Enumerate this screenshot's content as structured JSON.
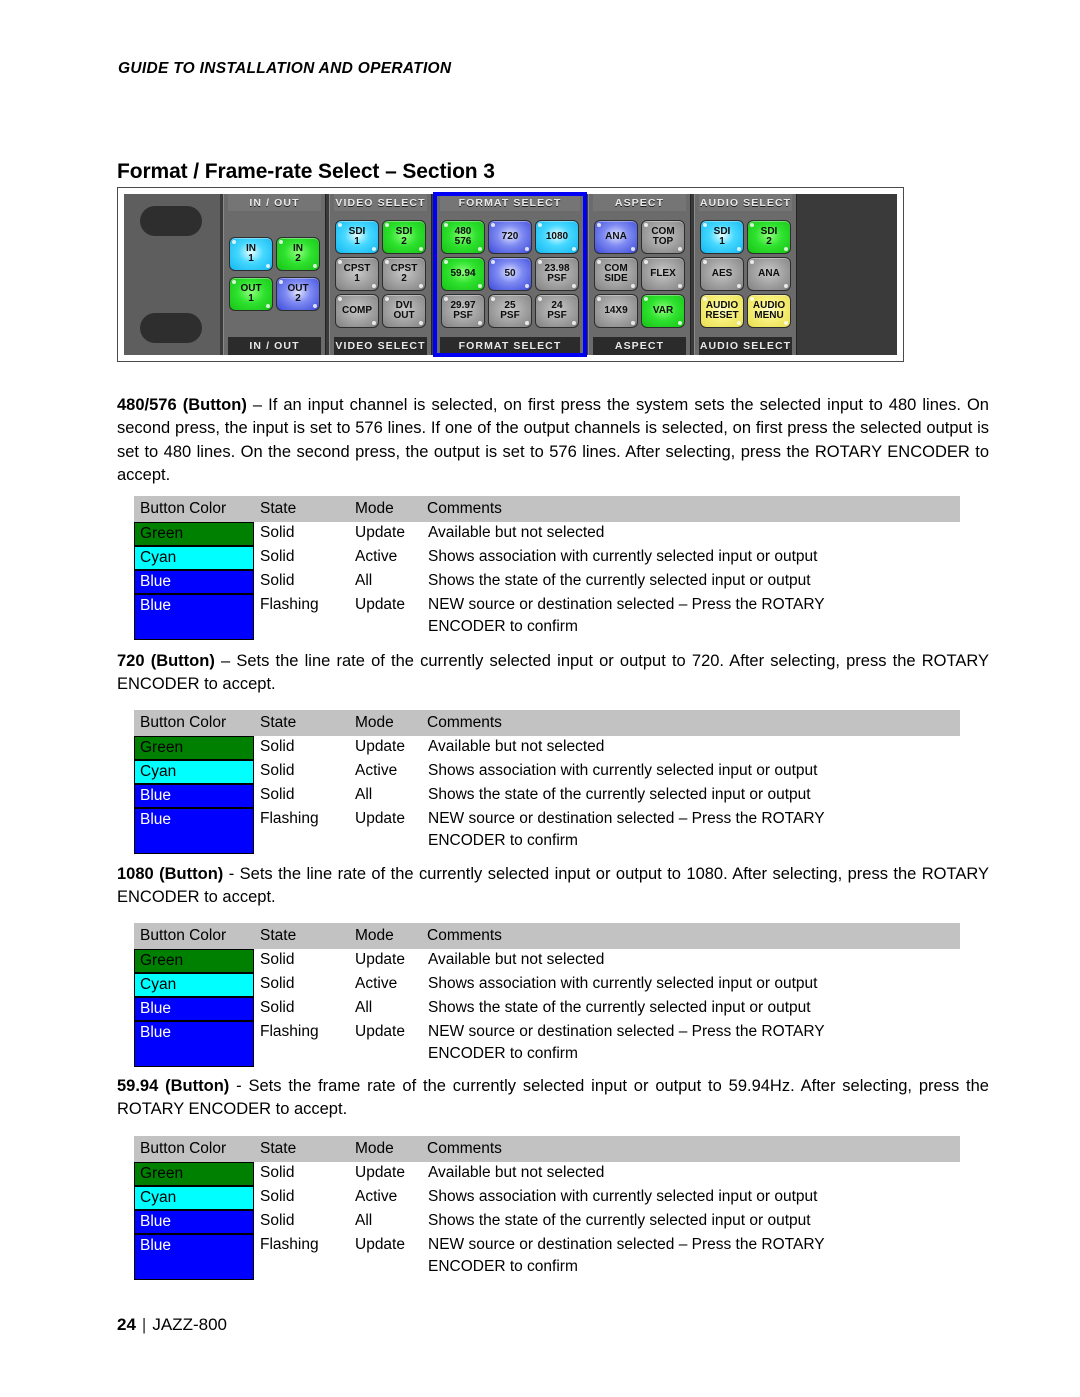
{
  "running_head": "GUIDE TO INSTALLATION AND OPERATION",
  "section_title": "Format / Frame-rate Select – Section 3",
  "footer": {
    "page_number": "24",
    "separator": "|",
    "product": "JAZZ-800"
  },
  "panel": {
    "groups": [
      {
        "name": "in-out",
        "label_top": "IN / OUT",
        "label_bottom": "IN / OUT",
        "columns": 2,
        "buttons": [
          {
            "label": "IN 1",
            "lines": [
              "IN",
              "1"
            ],
            "color": "cyan"
          },
          {
            "label": "IN 2",
            "lines": [
              "IN",
              "2"
            ],
            "color": "green"
          },
          {
            "label": "",
            "lines": [],
            "color": "empty"
          },
          {
            "label": "",
            "lines": [],
            "color": "empty"
          },
          {
            "label": "OUT 1",
            "lines": [
              "OUT",
              "1"
            ],
            "color": "green"
          },
          {
            "label": "OUT 2",
            "lines": [
              "OUT",
              "2"
            ],
            "color": "blue"
          }
        ]
      },
      {
        "name": "video-select",
        "label_top": "VIDEO SELECT",
        "label_bottom": "VIDEO SELECT",
        "columns": 2,
        "buttons": [
          {
            "label": "SDI 1",
            "lines": [
              "SDI",
              "1"
            ],
            "color": "cyan"
          },
          {
            "label": "SDI 2",
            "lines": [
              "SDI",
              "2"
            ],
            "color": "green"
          },
          {
            "label": "CPST 1",
            "lines": [
              "CPST",
              "1"
            ],
            "color": "gray"
          },
          {
            "label": "CPST 2",
            "lines": [
              "CPST",
              "2"
            ],
            "color": "gray"
          },
          {
            "label": "COMP",
            "lines": [
              "COMP"
            ],
            "color": "gray"
          },
          {
            "label": "DVI OUT",
            "lines": [
              "DVI",
              "OUT"
            ],
            "color": "gray"
          }
        ]
      },
      {
        "name": "format-select",
        "label_top": "FORMAT SELECT",
        "label_bottom": "FORMAT SELECT",
        "columns": 3,
        "highlighted": true,
        "buttons": [
          {
            "label": "480/576",
            "lines": [
              "480",
              "576"
            ],
            "color": "green"
          },
          {
            "label": "720",
            "lines": [
              "720"
            ],
            "color": "blue"
          },
          {
            "label": "1080",
            "lines": [
              "1080"
            ],
            "color": "cyan"
          },
          {
            "label": "59.94",
            "lines": [
              "59.94"
            ],
            "color": "green"
          },
          {
            "label": "50",
            "lines": [
              "50"
            ],
            "color": "blue"
          },
          {
            "label": "23.98 PSF",
            "lines": [
              "23.98",
              "PSF"
            ],
            "color": "gray"
          },
          {
            "label": "29.97 PSF",
            "lines": [
              "29.97",
              "PSF"
            ],
            "color": "gray"
          },
          {
            "label": "25 PSF",
            "lines": [
              "25",
              "PSF"
            ],
            "color": "gray"
          },
          {
            "label": "24 PSF",
            "lines": [
              "24",
              "PSF"
            ],
            "color": "gray"
          }
        ]
      },
      {
        "name": "aspect",
        "label_top": "ASPECT",
        "label_bottom": "ASPECT",
        "columns": 2,
        "buttons": [
          {
            "label": "ANA",
            "lines": [
              "ANA"
            ],
            "color": "blue"
          },
          {
            "label": "COM TOP",
            "lines": [
              "COM",
              "TOP"
            ],
            "color": "gray"
          },
          {
            "label": "COM SIDE",
            "lines": [
              "COM",
              "SIDE"
            ],
            "color": "gray"
          },
          {
            "label": "FLEX",
            "lines": [
              "FLEX"
            ],
            "color": "gray"
          },
          {
            "label": "14X9",
            "lines": [
              "14X9"
            ],
            "color": "gray"
          },
          {
            "label": "VAR",
            "lines": [
              "VAR"
            ],
            "color": "green"
          }
        ]
      },
      {
        "name": "audio-select",
        "label_top": "AUDIO SELECT",
        "label_bottom": "AUDIO SELECT",
        "columns": 2,
        "buttons": [
          {
            "label": "SDI 1",
            "lines": [
              "SDI",
              "1"
            ],
            "color": "cyan"
          },
          {
            "label": "SDI 2",
            "lines": [
              "SDI",
              "2"
            ],
            "color": "green"
          },
          {
            "label": "AES",
            "lines": [
              "AES"
            ],
            "color": "gray"
          },
          {
            "label": "ANA",
            "lines": [
              "ANA"
            ],
            "color": "gray"
          },
          {
            "label": "AUDIO RESET",
            "lines": [
              "AUDIO",
              "RESET"
            ],
            "color": "yellow"
          },
          {
            "label": "AUDIO MENU",
            "lines": [
              "AUDIO",
              "MENU"
            ],
            "color": "yellow"
          }
        ]
      }
    ]
  },
  "sections": [
    {
      "id": "sec-480-576",
      "term": "480/576 (Button)",
      "dash": " – ",
      "body": "If an input channel is selected, on first press the system sets the selected input to 480 lines. On second press, the input is set to 576 lines. If one of the output channels is selected, on first press the selected output is set to 480 lines. On the second press, the output is set to 576 lines. After selecting, press the ROTARY ENCODER to accept."
    },
    {
      "id": "sec-720",
      "term": "720 (Button)",
      "dash": " – ",
      "body": "Sets the line rate of the currently selected input or output to 720. After selecting, press the ROTARY ENCODER to accept."
    },
    {
      "id": "sec-1080",
      "term": "1080 (Button)",
      "dash": " - ",
      "body": "Sets the line rate of the currently selected input or output to 1080. After selecting, press the ROTARY ENCODER to accept."
    },
    {
      "id": "sec-5994",
      "term": "59.94 (Button)",
      "dash": " - ",
      "body": "Sets the frame rate of the currently selected input or output to 59.94Hz. After selecting, press the ROTARY ENCODER to accept."
    }
  ],
  "table": {
    "headers": [
      "Button Color",
      "State",
      "Mode",
      "Comments"
    ],
    "rows": [
      {
        "color_label": "Green",
        "color_hex": "#008000",
        "text_hex": "#000000",
        "state": "Solid",
        "mode": "Update",
        "comments": "Available but not selected"
      },
      {
        "color_label": "Cyan",
        "color_hex": "#00FFFF",
        "text_hex": "#000000",
        "state": "Solid",
        "mode": "Active",
        "comments": "Shows association with currently selected input or output"
      },
      {
        "color_label": "Blue",
        "color_hex": "#0000FF",
        "text_hex": "#FFFFFF",
        "state": "Solid",
        "mode": "All",
        "comments": "Shows the state of the currently selected input or output"
      },
      {
        "color_label": "Blue",
        "color_hex": "#0000FF",
        "text_hex": "#FFFFFF",
        "state": "Flashing",
        "mode": "Update",
        "comments": "NEW source or destination selected – Press the ROTARY",
        "comments_line2": "ENCODER to confirm"
      }
    ],
    "header_bg_hex": "#C2C2C2"
  }
}
